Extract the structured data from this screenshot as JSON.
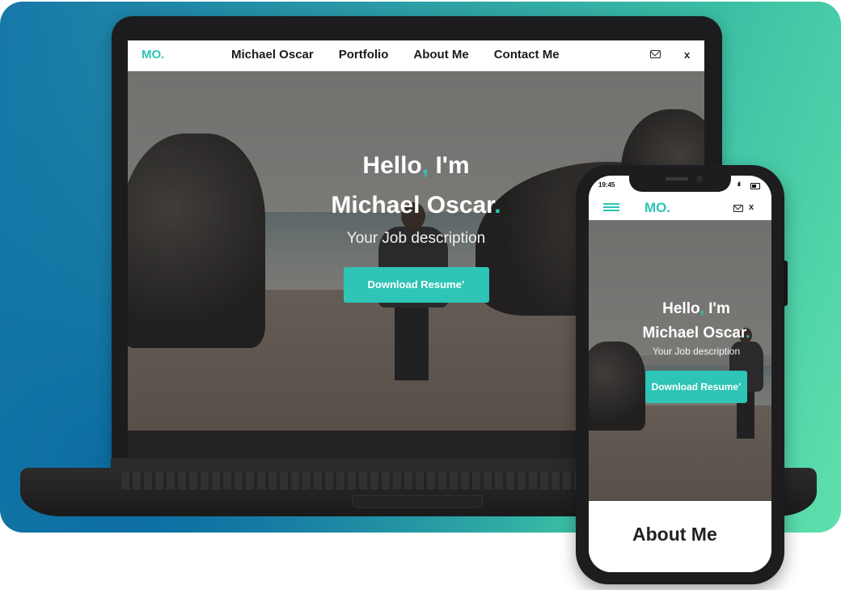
{
  "laptop": {
    "nav": {
      "logo": "MO.",
      "items": [
        "Michael Oscar",
        "Portfolio",
        "About Me",
        "Contact Me"
      ],
      "icons": [
        "mail-icon",
        "x-icon"
      ],
      "x_label": "x"
    },
    "hero": {
      "greeting": "Hello",
      "comma": ",",
      "im": " I'm",
      "name": "Michael Oscar",
      "dot": ".",
      "subtitle": "Your Job description",
      "button": "Download Resume’"
    }
  },
  "phone": {
    "status": {
      "time": "19:45",
      "signal": "ıll"
    },
    "nav": {
      "logo": "MO.",
      "icons": [
        "menu-icon",
        "mail-icon",
        "x-icon"
      ],
      "x_label": "x"
    },
    "hero": {
      "greeting": "Hello",
      "comma": ",",
      "im": " I'm",
      "name": "Michael Oscar",
      "dot": ".",
      "subtitle": "Your Job description",
      "button": "Download Resume’"
    },
    "section_title": "About Me"
  },
  "colors": {
    "accent": "#2ec4b6",
    "device": "#1d1d1f",
    "background_start": "#1778a8",
    "background_end": "#5ee0ac"
  }
}
